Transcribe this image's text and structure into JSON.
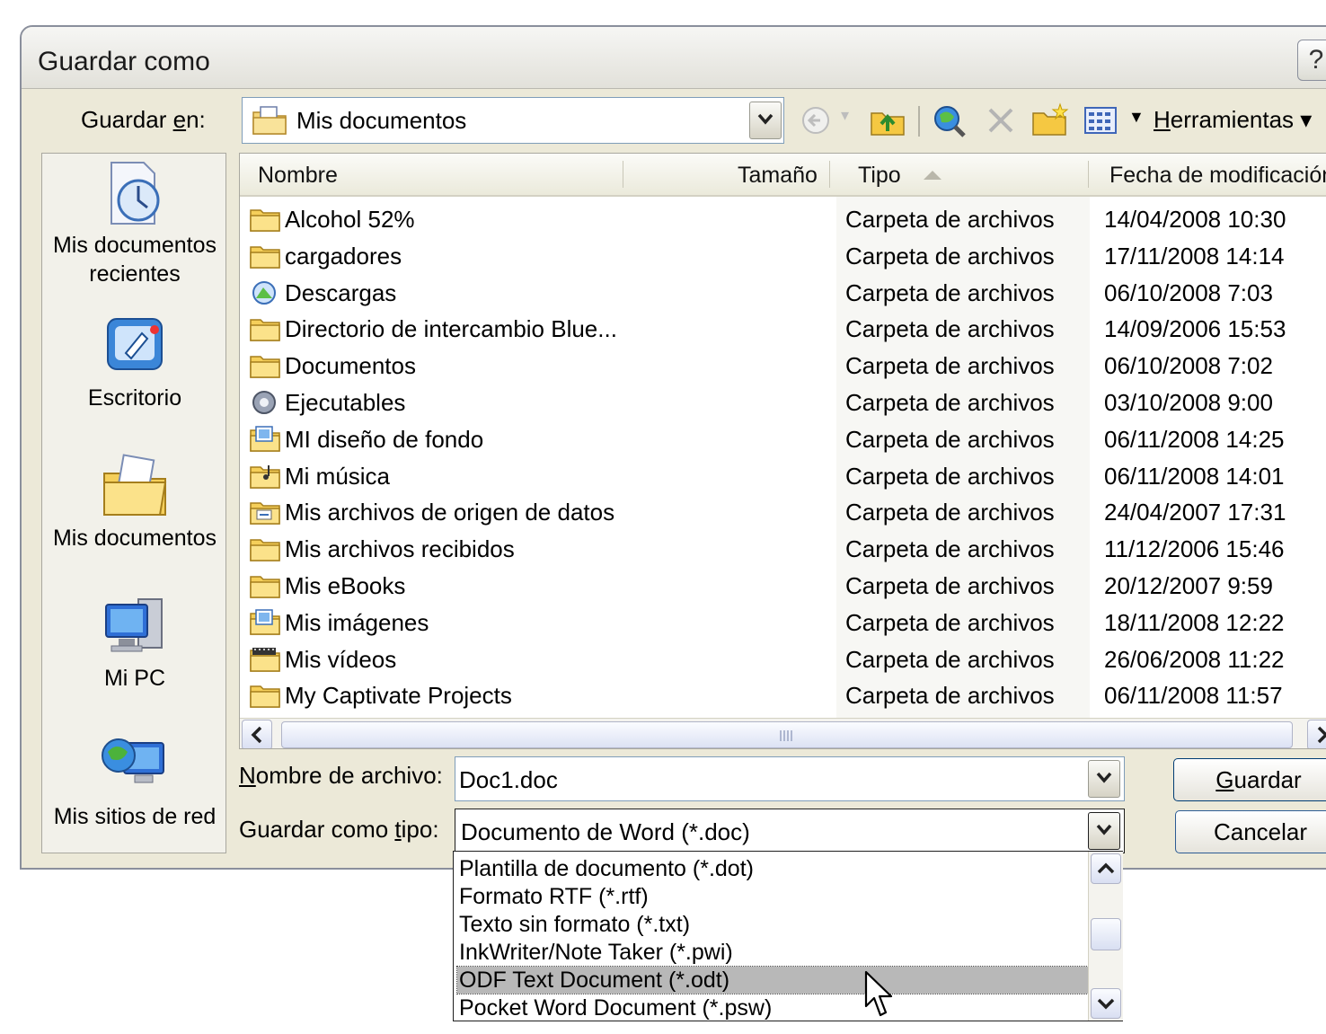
{
  "window": {
    "title": "Guardar como",
    "help_label": "?"
  },
  "toolbar": {
    "look_in_label": "Guardar en:",
    "look_in_value": "Mis documentos",
    "tools_label": "Herramientas"
  },
  "places": [
    {
      "label": "Mis documentos recientes",
      "icon": "recent-documents-icon"
    },
    {
      "label": "Escritorio",
      "icon": "desktop-icon"
    },
    {
      "label": "Mis documentos",
      "icon": "my-documents-icon"
    },
    {
      "label": "Mi PC",
      "icon": "my-computer-icon"
    },
    {
      "label": "Mis sitios de red",
      "icon": "network-places-icon"
    }
  ],
  "file_list": {
    "columns": [
      "Nombre",
      "Tamaño",
      "Tipo",
      "Fecha de modificación"
    ],
    "sorted_by": "Tipo",
    "rows": [
      {
        "name": "Alcohol 52%",
        "type": "Carpeta de archivos",
        "date": "14/04/2008 10:30",
        "icon": "folder-icon"
      },
      {
        "name": "cargadores",
        "type": "Carpeta de archivos",
        "date": "17/11/2008 14:14",
        "icon": "folder-icon"
      },
      {
        "name": "Descargas",
        "type": "Carpeta de archivos",
        "date": "06/10/2008 7:03",
        "icon": "downloads-folder-icon"
      },
      {
        "name": "Directorio de intercambio Blue...",
        "type": "Carpeta de archivos",
        "date": "14/09/2006 15:53",
        "icon": "folder-icon"
      },
      {
        "name": "Documentos",
        "type": "Carpeta de archivos",
        "date": "06/10/2008 7:02",
        "icon": "folder-icon"
      },
      {
        "name": "Ejecutables",
        "type": "Carpeta de archivos",
        "date": "03/10/2008 9:00",
        "icon": "gear-folder-icon"
      },
      {
        "name": "MI diseño de fondo",
        "type": "Carpeta de archivos",
        "date": "06/11/2008 14:25",
        "icon": "pictures-folder-icon"
      },
      {
        "name": "Mi música",
        "type": "Carpeta de archivos",
        "date": "06/11/2008 14:01",
        "icon": "music-folder-icon"
      },
      {
        "name": "Mis archivos de origen de datos",
        "type": "Carpeta de archivos",
        "date": "24/04/2007 17:31",
        "icon": "data-sources-folder-icon"
      },
      {
        "name": "Mis archivos recibidos",
        "type": "Carpeta de archivos",
        "date": "11/12/2006 15:46",
        "icon": "folder-icon"
      },
      {
        "name": "Mis eBooks",
        "type": "Carpeta de archivos",
        "date": "20/12/2007 9:59",
        "icon": "folder-icon"
      },
      {
        "name": "Mis imágenes",
        "type": "Carpeta de archivos",
        "date": "18/11/2008 12:22",
        "icon": "pictures-folder-icon"
      },
      {
        "name": "Mis vídeos",
        "type": "Carpeta de archivos",
        "date": "26/06/2008 11:22",
        "icon": "videos-folder-icon"
      },
      {
        "name": "My Captivate Projects",
        "type": "Carpeta de archivos",
        "date": "06/11/2008 11:57",
        "icon": "folder-icon"
      }
    ]
  },
  "form": {
    "filename_label": "Nombre de archivo:",
    "filename_value": "Doc1.doc",
    "filetype_label": "Guardar como tipo:",
    "filetype_value": "Documento de Word (*.doc)"
  },
  "buttons": {
    "save": "Guardar",
    "cancel": "Cancelar"
  },
  "filetype_options": [
    "Plantilla de documento (*.dot)",
    "Formato RTF (*.rtf)",
    "Texto sin formato (*.txt)",
    "InkWriter/Note Taker (*.pwi)",
    "ODF Text Document (*.odt)",
    "Pocket Word Document (*.psw)"
  ],
  "filetype_selected": "ODF Text Document (*.odt)",
  "colors": {
    "dialog_bg": "#ece9d8",
    "selection": "#b8b8b8",
    "border_blue": "#7f9db9"
  }
}
